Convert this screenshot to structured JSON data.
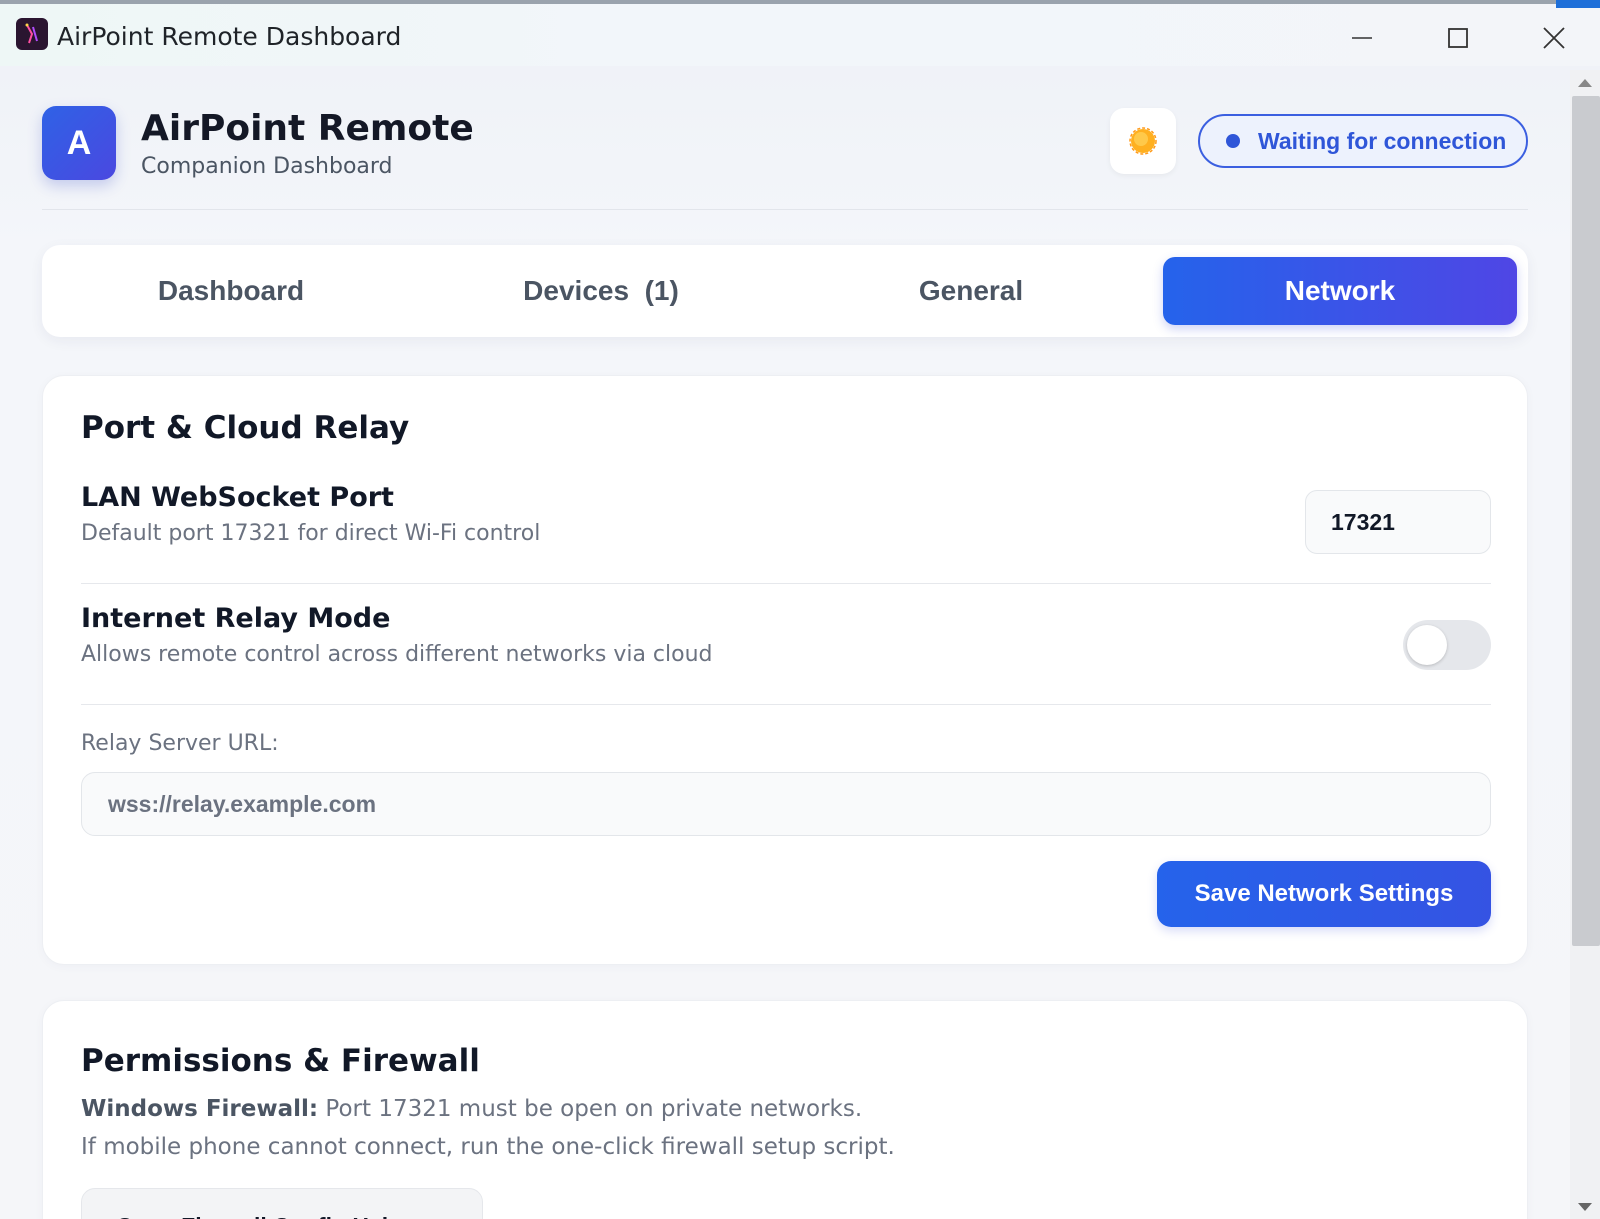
{
  "window": {
    "title": "AirPoint Remote Dashboard"
  },
  "header": {
    "logo_letter": "A",
    "app_name": "AirPoint Remote",
    "subtitle": "Companion Dashboard",
    "theme_icon": "sun-icon",
    "status": "Waiting for connection"
  },
  "tabs": [
    {
      "label": "Dashboard",
      "active": false
    },
    {
      "label": "Devices  (1)",
      "active": false
    },
    {
      "label": "General",
      "active": false
    },
    {
      "label": "Network",
      "active": true
    }
  ],
  "port_card": {
    "title": "Port & Cloud Relay",
    "lan_label": "LAN WebSocket Port",
    "lan_desc": "Default port 17321 for direct Wi-Fi control",
    "lan_value": "17321",
    "relay_label": "Internet Relay Mode",
    "relay_desc": "Allows remote control across different networks via cloud",
    "relay_enabled": false,
    "url_label": "Relay Server URL:",
    "url_placeholder": "wss://relay.example.com",
    "save_label": "Save Network Settings"
  },
  "firewall_card": {
    "title": "Permissions & Firewall",
    "line1_bold": "Windows Firewall:",
    "line1_rest": " Port 17321 must be open on private networks.",
    "line2": "If mobile phone cannot connect, run the one-click firewall setup script.",
    "button_label": "Open Firewall Config Helper"
  },
  "colors": {
    "accent": "#2563eb",
    "accent_end": "#4f46e5",
    "status": "#2f56d8"
  }
}
